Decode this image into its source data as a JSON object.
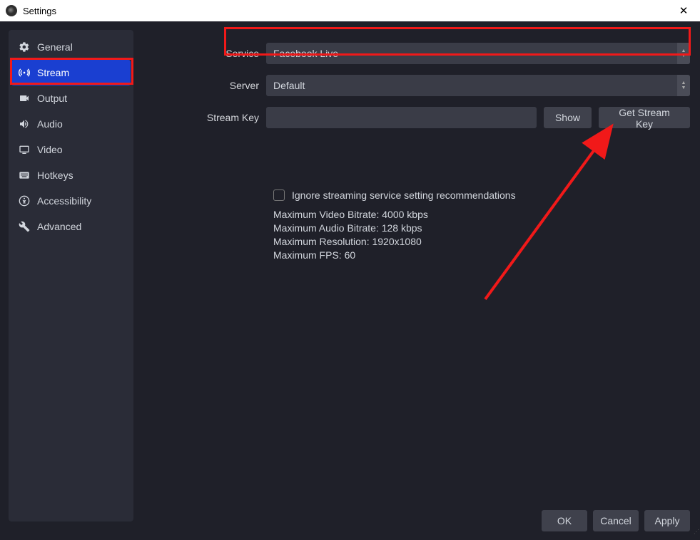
{
  "window": {
    "title": "Settings"
  },
  "sidebar": {
    "items": [
      {
        "label": "General"
      },
      {
        "label": "Stream"
      },
      {
        "label": "Output"
      },
      {
        "label": "Audio"
      },
      {
        "label": "Video"
      },
      {
        "label": "Hotkeys"
      },
      {
        "label": "Accessibility"
      },
      {
        "label": "Advanced"
      }
    ]
  },
  "stream": {
    "service_label": "Service",
    "service_value": "Facebook Live",
    "server_label": "Server",
    "server_value": "Default",
    "streamkey_label": "Stream Key",
    "streamkey_value": "",
    "show_btn": "Show",
    "getkey_btn": "Get Stream Key",
    "ignore_label": "Ignore streaming service setting recommendations",
    "ignore_checked": false,
    "limits": {
      "video_bitrate": "Maximum Video Bitrate: 4000 kbps",
      "audio_bitrate": "Maximum Audio Bitrate: 128 kbps",
      "resolution": "Maximum Resolution: 1920x1080",
      "fps": "Maximum FPS: 60"
    }
  },
  "footer": {
    "ok": "OK",
    "cancel": "Cancel",
    "apply": "Apply"
  }
}
